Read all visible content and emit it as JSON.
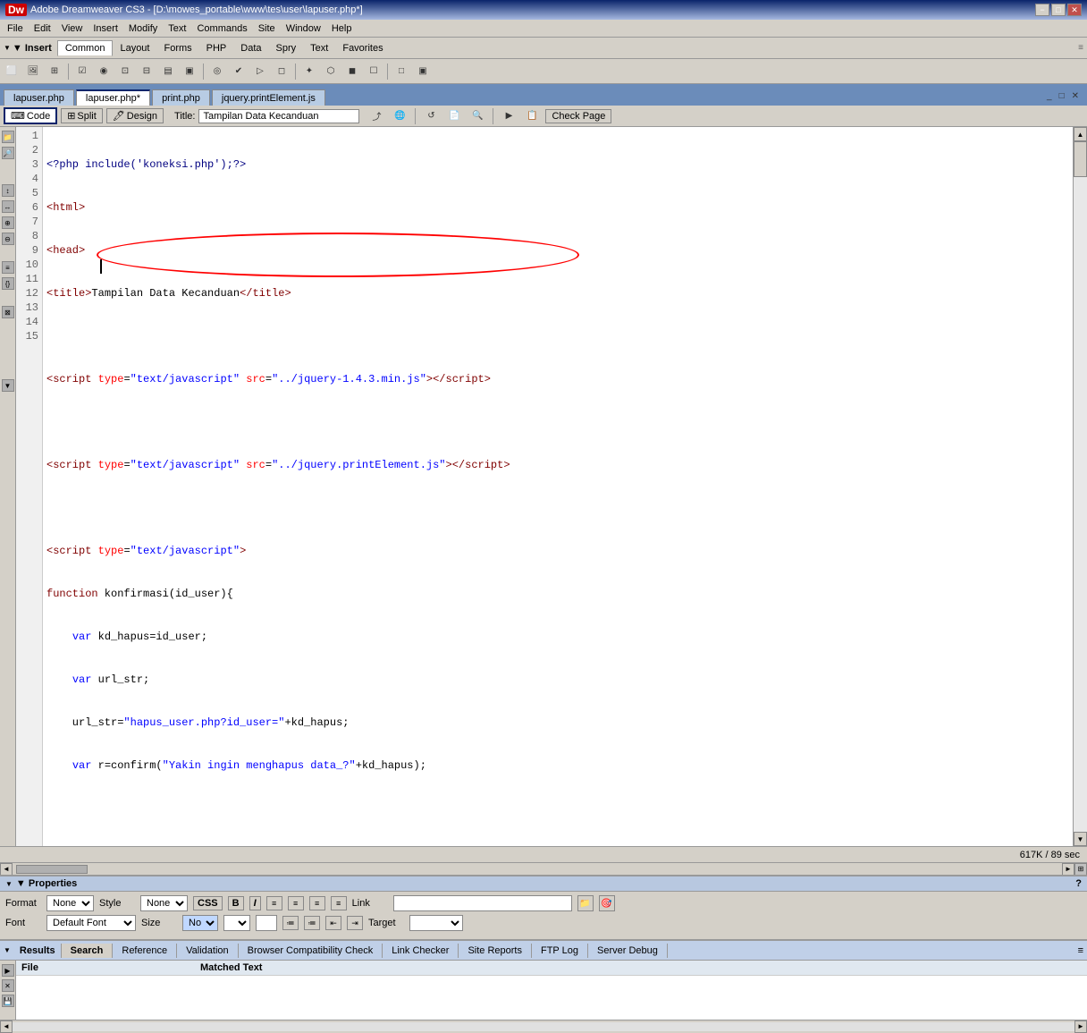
{
  "titlebar": {
    "title": "Adobe Dreamweaver CS3 - [D:\\mowes_portable\\www\\tes\\user\\lapuser.php*]",
    "dw_icon": "Dw",
    "minimize": "−",
    "restore": "□",
    "close": "✕"
  },
  "menubar": {
    "items": [
      "File",
      "Edit",
      "View",
      "Insert",
      "Modify",
      "Text",
      "Commands",
      "Site",
      "Window",
      "Help"
    ]
  },
  "insertbar": {
    "label": "▼ Insert",
    "tabs": [
      "Common",
      "Layout",
      "Forms",
      "PHP",
      "Data",
      "Spry",
      "Text",
      "Favorites"
    ]
  },
  "icons_row1": [
    "□",
    "⬜",
    "⊞",
    "☑",
    "◉",
    "⊡",
    "⊟",
    "▤",
    "▣",
    "◎",
    "✔",
    "▷",
    "◻",
    "◼",
    "☐",
    "□",
    "▣",
    "✦"
  ],
  "tabs": {
    "items": [
      "lapuser.php",
      "lapuser.php*",
      "print.php",
      "jquery.printElement.js"
    ],
    "active": 1
  },
  "codetoolbar": {
    "code_btn": "Code",
    "split_btn": "Split",
    "design_btn": "Design",
    "title_label": "Title:",
    "title_value": "Tampilan Data Kecanduan",
    "icon_refresh": "↺",
    "check_page": "Check Page"
  },
  "code": {
    "lines": [
      "1",
      "2",
      "3",
      "4",
      "5",
      "6",
      "7",
      "8",
      "9",
      "10",
      "11",
      "12",
      "13",
      "14",
      "15"
    ],
    "content": [
      "<?php include('koneksi.php');?>",
      "<html>",
      "<head>",
      "<title>Tampilan Data Kecanduan</title>",
      "",
      "<script type=\"text/javascript\" src=\"../jquery-1.4.3.min.js\"><\\/script>",
      "",
      "<script type=\"text/javascript\" src=\"../jquery.printElement.js\"><\\/script>",
      "",
      "<script type=\"text/javascript\">",
      "function konfirmasi(id_user){",
      "    var kd_hapus=id_user;",
      "    var url_str;",
      "    url_str=\"hapus_user.php?id_user=\"+kd_hapus;",
      "    var r=confirm(\"Yakin ingin menghapus data_?\"+kd_hapus);"
    ]
  },
  "statusbar": {
    "size": "617K / 89 sec"
  },
  "properties": {
    "header": "▼ Properties",
    "format_label": "Format",
    "format_value": "None",
    "style_label": "Style",
    "style_value": "None",
    "css_btn": "CSS",
    "bold_btn": "B",
    "italic_btn": "I",
    "link_label": "Link",
    "font_label": "Font",
    "font_value": "Default Font",
    "size_label": "Size",
    "size_value": "None",
    "target_label": "Target"
  },
  "results": {
    "header": "▼ Results",
    "tabs": [
      "Search",
      "Reference",
      "Validation",
      "Browser Compatibility Check",
      "Link Checker",
      "Site Reports",
      "FTP Log",
      "Server Debug"
    ],
    "active_tab": 0,
    "col_file": "File",
    "col_matched": "Matched Text"
  }
}
